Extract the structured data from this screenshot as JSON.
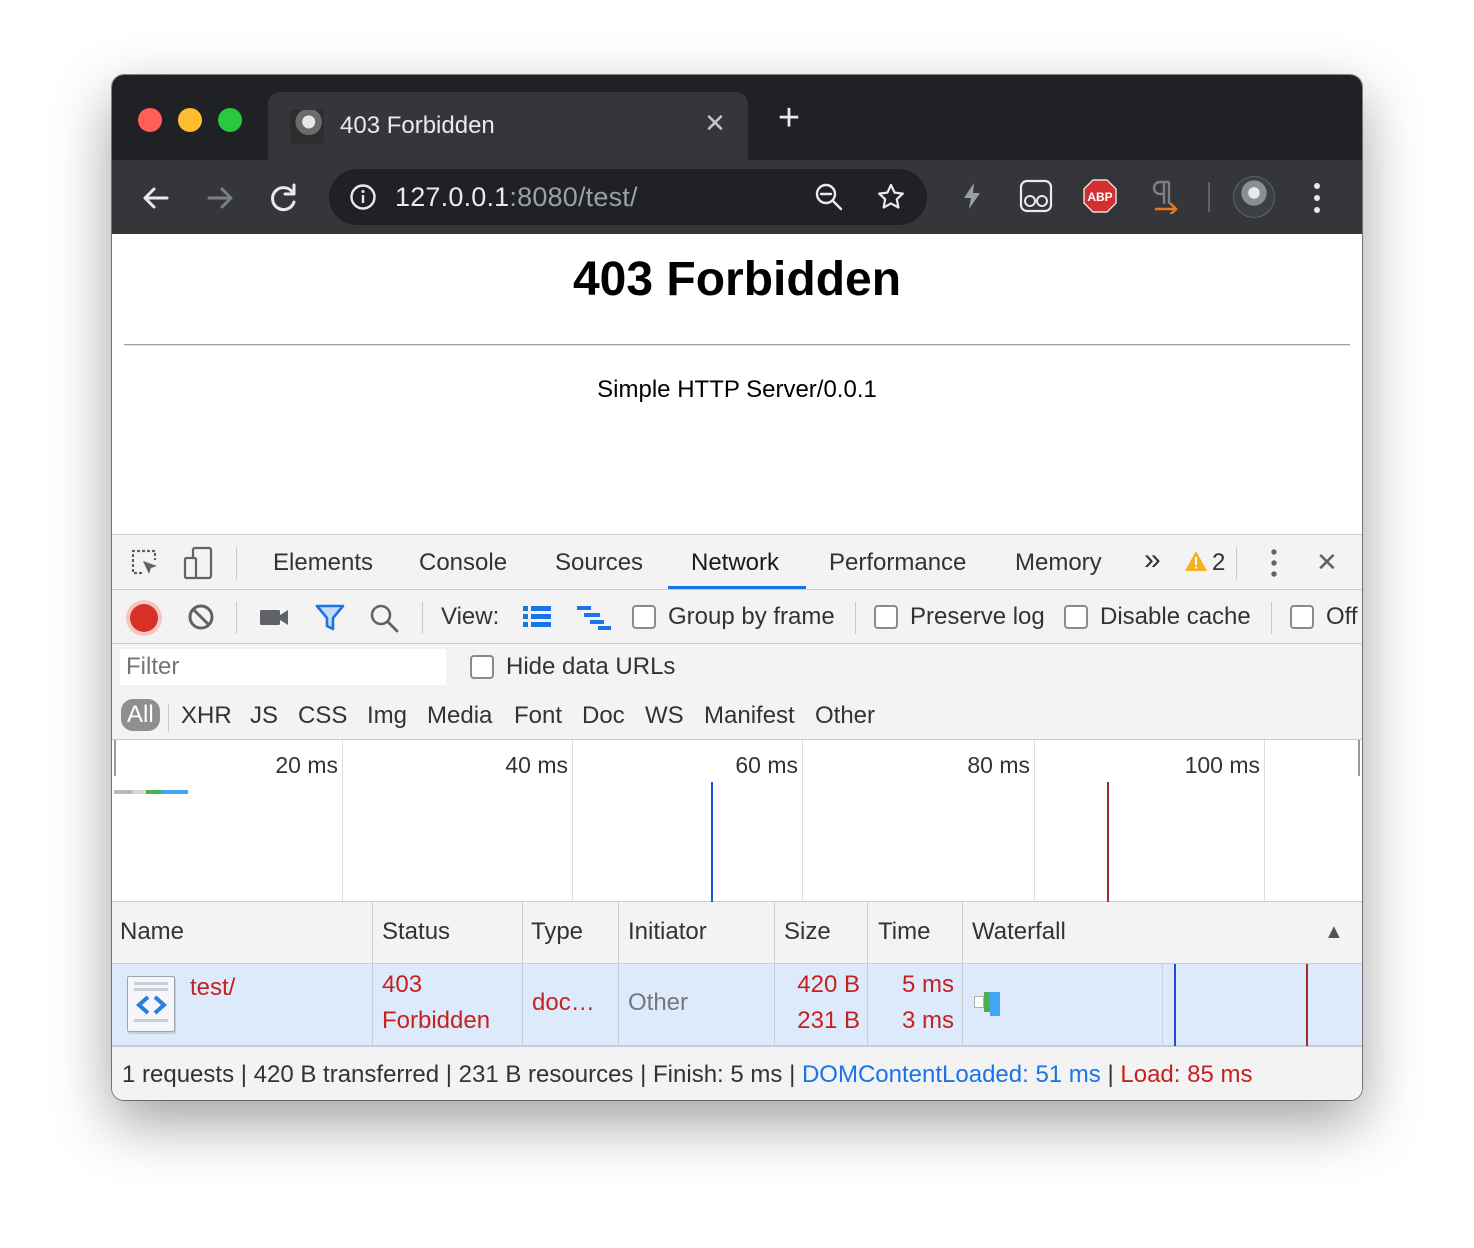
{
  "browser": {
    "tab_title": "403 Forbidden",
    "tab_close": "✕",
    "new_tab": "+",
    "url_host": "127.0.0.1",
    "url_rest": ":8080/test/",
    "abp_label": "ABP"
  },
  "page": {
    "heading": "403 Forbidden",
    "server": "Simple HTTP Server/0.0.1"
  },
  "devtools": {
    "tabs": [
      "Elements",
      "Console",
      "Sources",
      "Network",
      "Performance",
      "Memory"
    ],
    "active_tab": "Network",
    "more_tabs": "»",
    "warning_count": "2",
    "close": "✕",
    "toolbar": {
      "view_label": "View:",
      "group_by_frame": "Group by frame",
      "preserve_log": "Preserve log",
      "disable_cache": "Disable cache",
      "offline": "Off"
    },
    "filter": {
      "placeholder": "Filter",
      "hide_data_urls": "Hide data URLs",
      "types": [
        "All",
        "XHR",
        "JS",
        "CSS",
        "Img",
        "Media",
        "Font",
        "Doc",
        "WS",
        "Manifest",
        "Other"
      ],
      "active_type": "All"
    },
    "overview": {
      "ticks": [
        "20 ms",
        "40 ms",
        "60 ms",
        "80 ms",
        "100 ms"
      ],
      "domcontentloaded_ms": 51,
      "load_ms": 85,
      "colors": {
        "dcl": "#1a4fd8",
        "load": "#a52a2a"
      }
    },
    "table": {
      "headers": [
        "Name",
        "Status",
        "Type",
        "Initiator",
        "Size",
        "Time",
        "Waterfall"
      ],
      "sort_indicator": "▲",
      "rows": [
        {
          "name": "test/",
          "status_code": "403",
          "status_text": "Forbidden",
          "type": "doc…",
          "initiator": "Other",
          "size_transferred": "420 B",
          "size_resource": "231 B",
          "time_total": "5 ms",
          "time_latency": "3 ms"
        }
      ]
    },
    "summary": {
      "requests": "1 requests",
      "transferred": "420 B transferred",
      "resources": "231 B resources",
      "finish": "Finish: 5 ms",
      "dcl": "DOMContentLoaded: 51 ms",
      "load": "Load: 85 ms",
      "sep": "|"
    }
  }
}
